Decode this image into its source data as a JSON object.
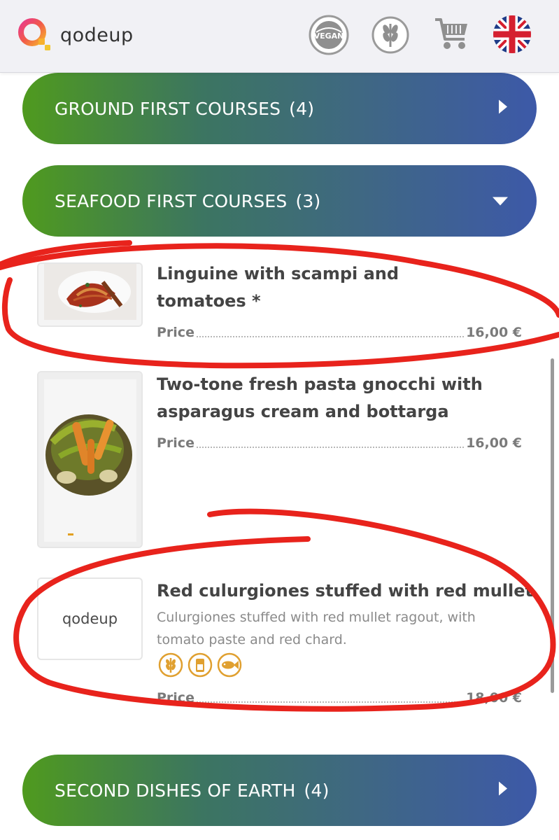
{
  "header": {
    "logo_text": "qodeup",
    "icons": [
      "vegan-badge-icon",
      "gluten-free-icon",
      "cart-icon",
      "uk-flag-icon"
    ],
    "vegan_badge_text": "VEGAN"
  },
  "categories": [
    {
      "name": "GROUND FIRST COURSES",
      "count": "(4)",
      "state": "collapsed"
    },
    {
      "name": "SEAFOOD FIRST COURSES",
      "count": "(3)",
      "state": "expanded"
    },
    {
      "name": "SECOND DISHES OF EARTH",
      "count": "(4)",
      "state": "collapsed"
    }
  ],
  "dishes": [
    {
      "name_line1": "Linguine with scampi and",
      "name_line2": "tomatoes *",
      "price_label": "Price",
      "price": "16,00 €"
    },
    {
      "name_line1": "Two-tone fresh pasta gnocchi with",
      "name_line2": "asparagus cream and bottarga",
      "price_label": "Price",
      "price": "16,00 €"
    },
    {
      "name": "Red culurgiones stuffed with red mullet",
      "description": "Culurgiones stuffed with red mullet ragout, with tomato paste and red chard.",
      "placeholder_logo": "qodeup",
      "allergens": [
        "gluten-icon",
        "dairy-icon",
        "fish-icon"
      ],
      "price_label": "Price",
      "price": "18,00 €"
    }
  ],
  "colors": {
    "gradient_start": "#4f9a1e",
    "gradient_end": "#3d59a8",
    "allergen": "#e0a030",
    "annotation": "#e8231c"
  }
}
